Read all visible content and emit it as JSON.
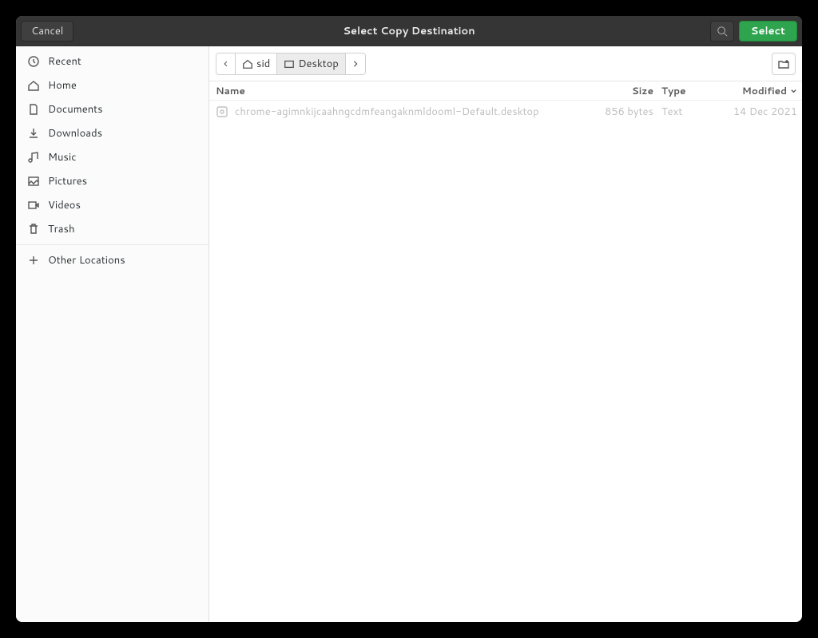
{
  "titlebar": {
    "cancel": "Cancel",
    "title": "Select Copy Destination",
    "select": "Select"
  },
  "sidebar": {
    "items": [
      {
        "icon": "clock-icon",
        "label": "Recent"
      },
      {
        "icon": "home-icon",
        "label": "Home"
      },
      {
        "icon": "documents-icon",
        "label": "Documents"
      },
      {
        "icon": "downloads-icon",
        "label": "Downloads"
      },
      {
        "icon": "music-icon",
        "label": "Music"
      },
      {
        "icon": "pictures-icon",
        "label": "Pictures"
      },
      {
        "icon": "videos-icon",
        "label": "Videos"
      },
      {
        "icon": "trash-icon",
        "label": "Trash"
      }
    ],
    "other": {
      "icon": "plus-icon",
      "label": "Other Locations"
    }
  },
  "breadcrumb": {
    "segments": [
      {
        "icon": "home-icon",
        "label": "sid",
        "active": false
      },
      {
        "icon": "folder-icon",
        "label": "Desktop",
        "active": true
      }
    ]
  },
  "columns": {
    "name": "Name",
    "size": "Size",
    "type": "Type",
    "modified": "Modified"
  },
  "files": [
    {
      "icon": "settings-icon",
      "name": "chrome-agimnkijcaahngcdmfeangaknmldooml-Default.desktop",
      "size": "856 bytes",
      "type": "Text",
      "modified": "14 Dec 2021"
    }
  ]
}
